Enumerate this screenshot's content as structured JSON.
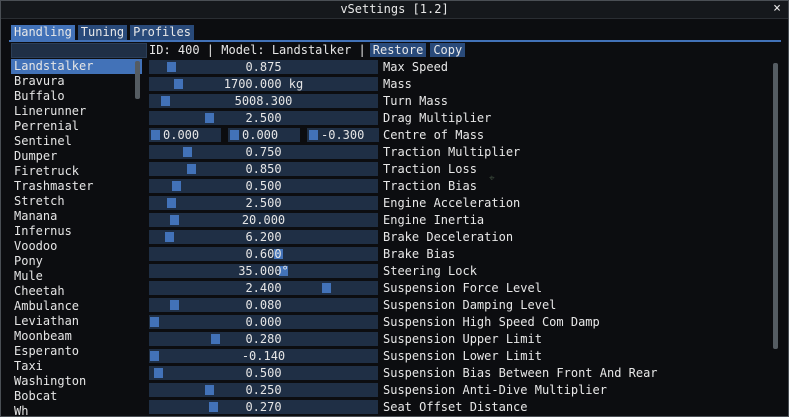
{
  "window": {
    "title": "vSettings [1.2]",
    "close_symbol": "×"
  },
  "tabs": [
    {
      "label": "Handling",
      "active": true
    },
    {
      "label": "Tuning",
      "active": false
    },
    {
      "label": "Profiles",
      "active": false
    }
  ],
  "info": {
    "id_text": "ID: 400 | Model: Landstalker |",
    "restore_label": "Restore",
    "copy_label": "Copy"
  },
  "vehicles": {
    "selected": "Landstalker",
    "items": [
      "Landstalker",
      "Bravura",
      "Buffalo",
      "Linerunner",
      "Perrenial",
      "Sentinel",
      "Dumper",
      "Firetruck",
      "Trashmaster",
      "Stretch",
      "Manana",
      "Infernus",
      "Voodoo",
      "Pony",
      "Mule",
      "Cheetah",
      "Ambulance",
      "Leviathan",
      "Moonbeam",
      "Esperanto",
      "Taxi",
      "Washington",
      "Bobcat",
      "Wh"
    ]
  },
  "params": [
    {
      "label": "Max Speed",
      "value": "0.875",
      "fraction": 0.08
    },
    {
      "label": "Mass",
      "value": "1700.000 kg",
      "fraction": 0.11
    },
    {
      "label": "Turn Mass",
      "value": "5008.300",
      "fraction": 0.05
    },
    {
      "label": "Drag Multiplier",
      "value": "2.500",
      "fraction": 0.25
    },
    {
      "label": "Centre of Mass",
      "vector": [
        "0.000",
        "0.000",
        "-0.300"
      ]
    },
    {
      "label": "Traction Multiplier",
      "value": "0.750",
      "fraction": 0.15
    },
    {
      "label": "Traction Loss",
      "value": "0.850",
      "fraction": 0.17
    },
    {
      "label": "Traction Bias",
      "value": "0.500",
      "fraction": 0.1
    },
    {
      "label": "Engine Acceleration",
      "value": "2.500",
      "fraction": 0.08
    },
    {
      "label": "Engine Inertia",
      "value": "20.000",
      "fraction": 0.09
    },
    {
      "label": "Brake Deceleration",
      "value": "6.200",
      "fraction": 0.07
    },
    {
      "label": "Brake Bias",
      "value": "0.600",
      "fraction": 0.57
    },
    {
      "label": "Steering Lock",
      "value": "35.000°",
      "fraction": 0.59
    },
    {
      "label": "Suspension Force Level",
      "value": "2.400",
      "fraction": 0.79
    },
    {
      "label": "Suspension Damping Level",
      "value": "0.080",
      "fraction": 0.09
    },
    {
      "label": "Suspension High Speed Com Damp",
      "value": "0.000",
      "fraction": 0.0
    },
    {
      "label": "Suspension Upper Limit",
      "value": "0.280",
      "fraction": 0.28
    },
    {
      "label": "Suspension Lower Limit",
      "value": "-0.140",
      "fraction": 0.0
    },
    {
      "label": "Suspension Bias Between Front And Rear",
      "value": "0.500",
      "fraction": 0.02
    },
    {
      "label": "Suspension Anti-Dive Multiplier",
      "value": "0.250",
      "fraction": 0.25
    },
    {
      "label": "Seat Offset Distance",
      "value": "0.270",
      "fraction": 0.27
    }
  ]
}
